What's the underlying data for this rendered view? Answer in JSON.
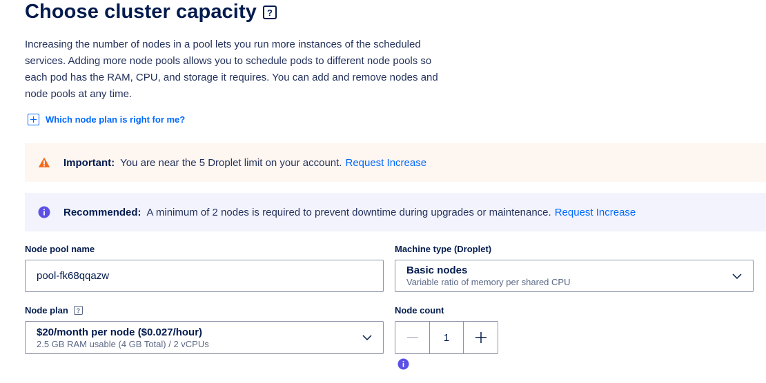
{
  "header": {
    "title": "Choose cluster capacity",
    "help_glyph": "?"
  },
  "description": "Increasing the number of nodes in a pool lets you run more instances of the scheduled services. Adding more node pools allows you to schedule pods to different node pools so each pod has the RAM, CPU, and storage it requires. You can add and remove nodes and node pools at any time.",
  "plan_help_link": "Which node plan is right for me?",
  "alerts": {
    "warning": {
      "label": "Important:",
      "text": "You are near the 5 Droplet limit on your account.",
      "link": "Request Increase",
      "icon": "warning-triangle-icon",
      "color": "#f26b1d"
    },
    "info": {
      "label": "Recommended:",
      "text": "A minimum of 2 nodes is required to prevent downtime during upgrades or maintenance.",
      "link": "Request Increase",
      "icon": "info-circle-icon",
      "color": "#5d50e6"
    }
  },
  "form": {
    "pool_name_label": "Node pool name",
    "pool_name_value": "pool-fk68qqazw",
    "machine_type_label": "Machine type (Droplet)",
    "machine_type_value": "Basic nodes",
    "machine_type_sub": "Variable ratio of memory per shared CPU",
    "node_plan_label": "Node plan",
    "node_plan_help": "?",
    "node_plan_value": "$20/month per node ($0.027/hour)",
    "node_plan_sub": "2.5 GB RAM usable (4 GB Total) / 2 vCPUs",
    "node_count_label": "Node count",
    "node_count_value": "1"
  },
  "colors": {
    "primary": "#0069ff",
    "text": "#031b4e",
    "muted": "#5b6987",
    "warning_bg": "#fdf6f1",
    "info_bg": "#f3f3fd"
  }
}
